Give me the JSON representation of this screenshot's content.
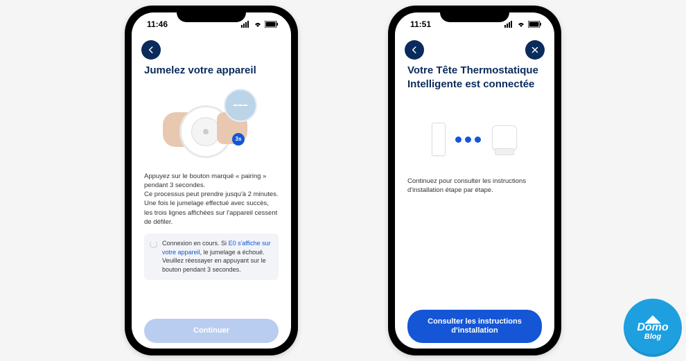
{
  "phone1": {
    "status_time": "11:46",
    "title": "Jumelez votre appareil",
    "badge": "3s",
    "description": "Appuyez sur le bouton marqué « pairing » pendant 3 secondes.\nCe processus peut prendre jusqu'à 2 minutes. Une fois le jumelage effectué avec succès, les trois lignes affichées sur l'appareil cessent de défiler.",
    "info_prefix": "Connexion en cours. Si ",
    "info_link": "E0 s'affiche sur votre appareil",
    "info_suffix": ", le jumelage a échoué. Veuillez réessayer en appuyant sur le bouton pendant 3 secondes.",
    "cta": "Continuer"
  },
  "phone2": {
    "status_time": "11:51",
    "title": "Votre Tête Thermostatique Intelligente est connectée",
    "description": "Continuez pour consulter les instructions d'installation étape par étape.",
    "cta": "Consulter les instructions d'installation"
  },
  "watermark": {
    "line1": "Domo",
    "line2": "Blog"
  }
}
